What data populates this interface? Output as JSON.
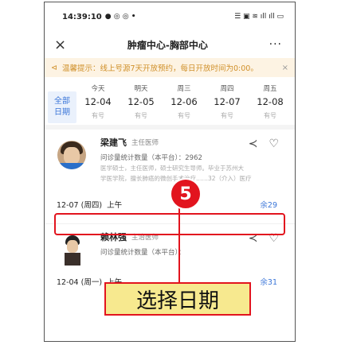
{
  "status_bar": {
    "time": "14:39:10",
    "left_icons": "● ◎ ◎ •",
    "right_icons": "☰ ▣ ≋ ıll ıll ▭"
  },
  "navbar": {
    "close": "×",
    "title": "肿瘤中心-胸部中心",
    "more": "···"
  },
  "notice": {
    "icon": "⊲",
    "text": "温馨提示：线上号源7天开放预约，每日开放时间为0:00。",
    "close": "×"
  },
  "date_picker": {
    "all_label_1": "全部",
    "all_label_2": "日期",
    "days": [
      {
        "weekday": "今天",
        "date": "12-04",
        "status": "有号"
      },
      {
        "weekday": "明天",
        "date": "12-05",
        "status": "有号"
      },
      {
        "weekday": "周三",
        "date": "12-06",
        "status": "有号"
      },
      {
        "weekday": "周四",
        "date": "12-07",
        "status": "有号"
      },
      {
        "weekday": "周五",
        "date": "12-08",
        "status": "有号"
      }
    ]
  },
  "doctors": [
    {
      "name": "梁建飞",
      "level": "主任医师",
      "stat": "问诊量统计数量（本平台）：2962",
      "desc_1": "医学硕士，主任医师，硕士研究生导师。毕业于苏州大",
      "desc_2": "学医学院，擅长肺癌的微创手术治疗……32（介入）医疗"
    },
    {
      "name": "赖林强",
      "level": "主治医师",
      "stat": "问诊量统计数量（本平台）：",
      "desc_1": ""
    }
  ],
  "slots": [
    {
      "date": "12-07 (周四)",
      "period": "上午",
      "remain": "余29"
    },
    {
      "date": "12-04 (周一)",
      "period": "上午",
      "remain": "余31"
    }
  ],
  "annotation": {
    "step": "5",
    "label": "选择日期"
  },
  "icons": {
    "share": "share-icon",
    "favorite": "heart-icon"
  },
  "colors": {
    "accent": "#3a75d8",
    "highlight": "#e2141e",
    "notice_text": "#d0902a",
    "label_bg": "#f7e98f"
  }
}
